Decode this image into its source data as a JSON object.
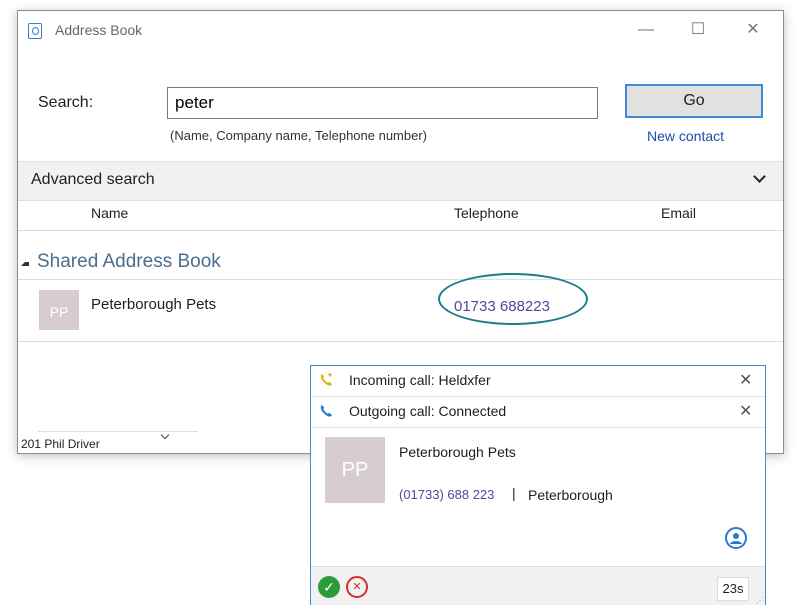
{
  "window": {
    "title": "Address Book",
    "minimize": "—",
    "maximize": "☐",
    "close": "✕"
  },
  "search": {
    "label": "Search:",
    "value": "peter",
    "hint": "(Name, Company name, Telephone number)",
    "go_label": "Go",
    "new_contact_label": "New contact"
  },
  "advanced": {
    "label": "Advanced search"
  },
  "columns": [
    "Name",
    "Telephone",
    "Email"
  ],
  "group": {
    "title": "Shared Address Book"
  },
  "results": [
    {
      "avatar": "PP",
      "name": "Peterborough Pets",
      "telephone": "01733 688223",
      "email": ""
    }
  ],
  "status": {
    "user": "201 Phil Driver"
  },
  "popup": {
    "calls": [
      {
        "text": "Incoming call: Heldxfer",
        "icon": "phone-transfer-icon",
        "color": "#e3b21e"
      },
      {
        "text": "Outgoing call: Connected",
        "icon": "phone-icon",
        "color": "#2b79d1"
      }
    ],
    "contact": {
      "avatar": "PP",
      "name": "Peterborough Pets",
      "phone": "(01733) 688 223",
      "separator": "|",
      "location": "Peterborough"
    },
    "timer": "23s"
  },
  "colors": {
    "accent": "#3f8ad8",
    "link": "#1d4ea6",
    "group": "#4a6e8d",
    "highlight_ring": "#1c7d8c",
    "answer": "#2d9b3a",
    "reject": "#d42e2e"
  }
}
